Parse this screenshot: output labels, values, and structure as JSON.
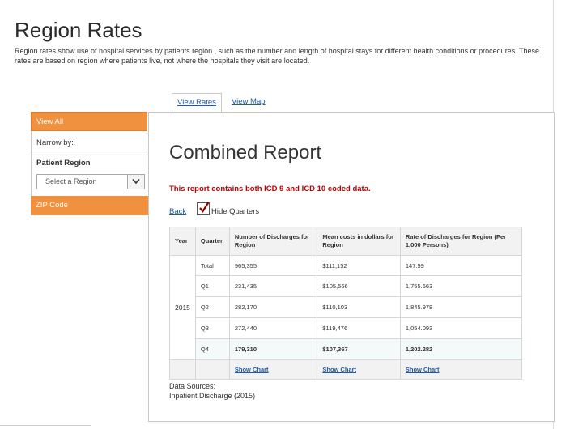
{
  "page": {
    "title": "Region Rates",
    "description": "Region rates show use of hospital services by patients region , such as the number and length of hospital stays for different health conditions or procedures. These rates are based on region where patients live, not where the hospitals they visit are located."
  },
  "tabs": [
    {
      "label": "View Rates",
      "active": true
    },
    {
      "label": "View Map",
      "active": false
    }
  ],
  "sidebar": {
    "view_all": "View All",
    "narrow_by": "Narrow by:",
    "patient_region_label": "Patient Region",
    "region_select_placeholder": "Select a Region",
    "zip_code": "ZIP Code"
  },
  "report": {
    "title": "Combined Report",
    "note": "This report contains both ICD 9 and ICD 10 coded data.",
    "back_label": "Back",
    "hide_quarters_label": "Hide Quarters",
    "hide_quarters_checked": true,
    "columns": [
      "Year",
      "Quarter",
      "Number of Discharges for Region",
      "Mean costs in dollars for Region",
      "Rate of Discharges for Region (Per 1,000 Persons)"
    ],
    "year": "2015",
    "rows": [
      {
        "quarter": "Total",
        "discharges": "965,355",
        "mean_cost": "$111,152",
        "rate": "147.99"
      },
      {
        "quarter": "Q1",
        "discharges": "231,435",
        "mean_cost": "$105,566",
        "rate": "1,755.663"
      },
      {
        "quarter": "Q2",
        "discharges": "282,170",
        "mean_cost": "$110,103",
        "rate": "1,845.978"
      },
      {
        "quarter": "Q3",
        "discharges": "272,440",
        "mean_cost": "$119,476",
        "rate": "1,054.093"
      },
      {
        "quarter": "Q4",
        "discharges": "179,310",
        "mean_cost": "$107,367",
        "rate": "1,202.282"
      }
    ],
    "show_chart_label": "Show Chart",
    "sources_label": "Data Sources:",
    "source": "Inpatient Discharge (2015)"
  },
  "colors": {
    "accent_orange": "#f0913f",
    "link_blue": "#1f5aa6",
    "note_red": "#c00000"
  }
}
